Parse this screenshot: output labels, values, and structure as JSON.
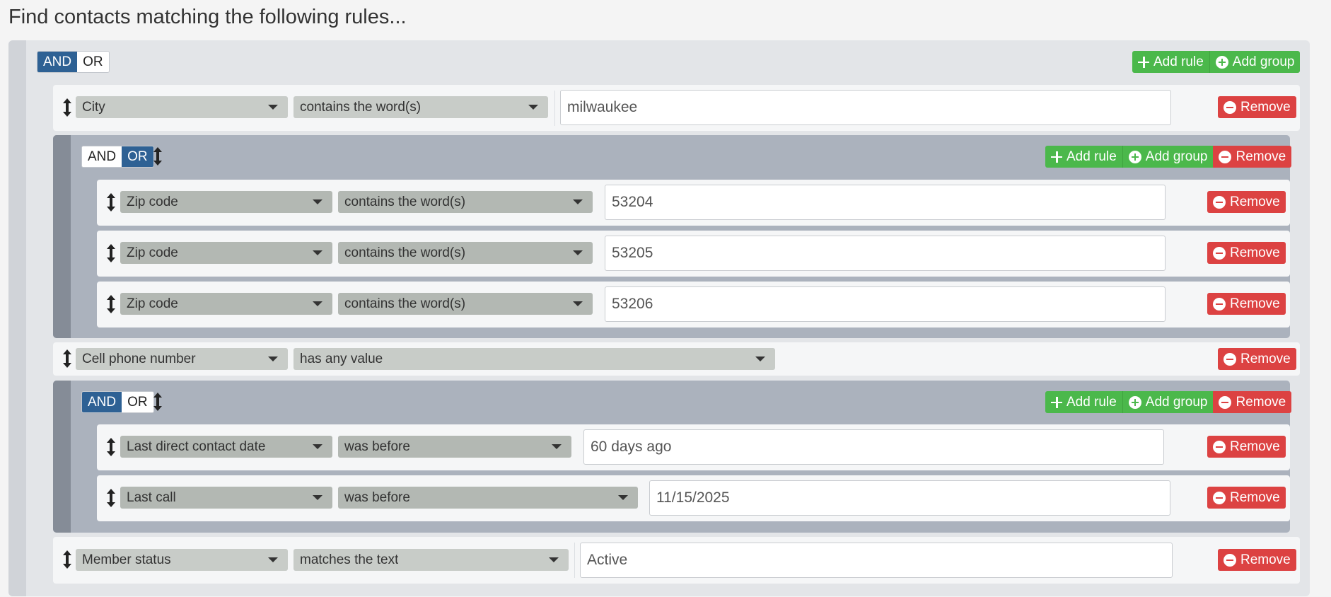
{
  "page": {
    "title": "Find contacts matching the following rules..."
  },
  "labels": {
    "and": "AND",
    "or": "OR",
    "add_rule": "Add rule",
    "add_group": "Add group",
    "remove": "Remove"
  },
  "root": {
    "combinator": "AND",
    "rules": [
      {
        "field": "City",
        "operator": "contains the word(s)",
        "value": "milwaukee"
      },
      {
        "field": "Cell phone number",
        "operator": "has any value"
      },
      {
        "field": "Member status",
        "operator": "matches the text",
        "value": "Active"
      }
    ],
    "groups": [
      {
        "combinator": "OR",
        "rules": [
          {
            "field": "Zip code",
            "operator": "contains the word(s)",
            "value": "53204"
          },
          {
            "field": "Zip code",
            "operator": "contains the word(s)",
            "value": "53205"
          },
          {
            "field": "Zip code",
            "operator": "contains the word(s)",
            "value": "53206"
          }
        ]
      },
      {
        "combinator": "AND",
        "rules": [
          {
            "field": "Last direct contact date",
            "operator": "was before",
            "value": "60 days ago"
          },
          {
            "field": "Last call",
            "operator": "was before",
            "value": "11/15/2025"
          }
        ]
      }
    ]
  },
  "colors": {
    "active_toggle": "#2e6194",
    "add_button": "#4bb84b",
    "remove_button": "#dc4242"
  },
  "icons": [
    "drag-handle-icon",
    "caret-down-icon",
    "plus-icon",
    "plus-circle-icon",
    "minus-circle-icon"
  ]
}
